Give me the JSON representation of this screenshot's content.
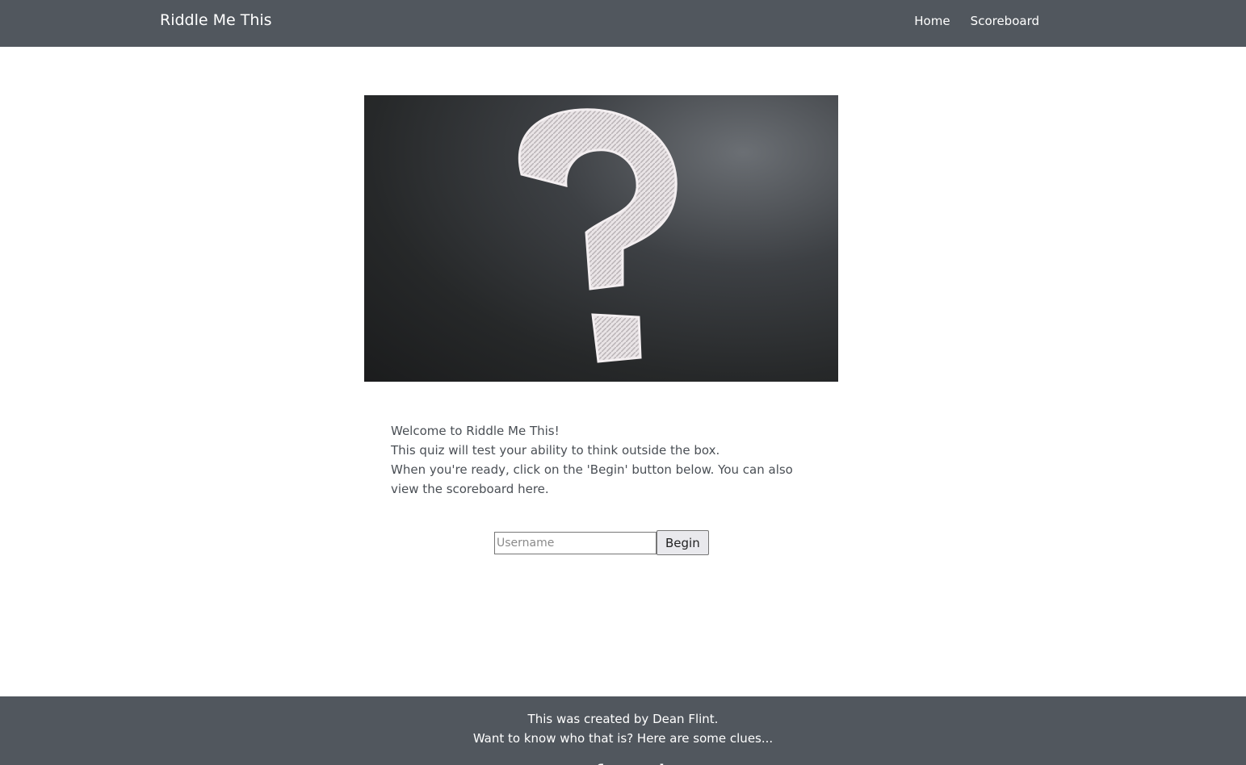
{
  "navbar": {
    "brand": "Riddle Me This",
    "links": [
      {
        "label": "Home"
      },
      {
        "label": "Scoreboard"
      }
    ]
  },
  "hero": {
    "icon": "question-mark-chalkboard"
  },
  "intro": {
    "line1": "Welcome to Riddle Me This!",
    "line2": "This quiz will test your ability to think outside the box.",
    "line3": "When you're ready, click on the 'Begin' button below. You can also view the scoreboard here."
  },
  "form": {
    "username_placeholder": "Username",
    "username_value": "",
    "begin_label": "Begin"
  },
  "footer": {
    "line1": "This was created by Dean Flint.",
    "line2": "Want to know who that is? Here are some clues...",
    "social_icons": [
      "github-icon",
      "facebook-icon",
      "linkedin-icon"
    ]
  },
  "colors": {
    "navbar_bg": "#51575e",
    "footer_bg": "#51575e",
    "text": "#444b52"
  }
}
